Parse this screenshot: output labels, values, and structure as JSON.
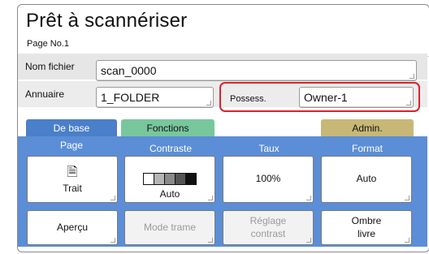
{
  "header": {
    "title": "Prêt à scannériser",
    "subtitle": "Page No.1"
  },
  "fields": {
    "filename": {
      "label": "Nom fichier",
      "value": "scan_0000"
    },
    "directory": {
      "label": "Annuaire",
      "value": "1_FOLDER"
    },
    "owner": {
      "label": "Possess.",
      "value": "Owner-1"
    }
  },
  "tabs": [
    {
      "label": "De base"
    },
    {
      "label": "Fonctions"
    },
    {
      "label": "Admin."
    }
  ],
  "columns": [
    "Page",
    "Contraste",
    "Taux",
    "Format"
  ],
  "buttons": {
    "page": {
      "label": "Trait",
      "icon": "document-icon"
    },
    "contrast": {
      "label": "Auto",
      "levels": 5,
      "selected_level": 5
    },
    "rate": {
      "label": "100%"
    },
    "format": {
      "label": "Auto"
    },
    "preview": {
      "label": "Aperçu"
    },
    "screen_mode": {
      "label": "Mode trame"
    },
    "contrast_adjust": {
      "label": "Réglage\ncontrast"
    },
    "book_shadow": {
      "label": "Ombre\nlivre"
    }
  },
  "colors": {
    "tab_base": "#4a7fc9",
    "tab_functions": "#78c79c",
    "tab_admin": "#c7b877",
    "panel": "#5b8ed6",
    "highlight": "#e0202a"
  }
}
